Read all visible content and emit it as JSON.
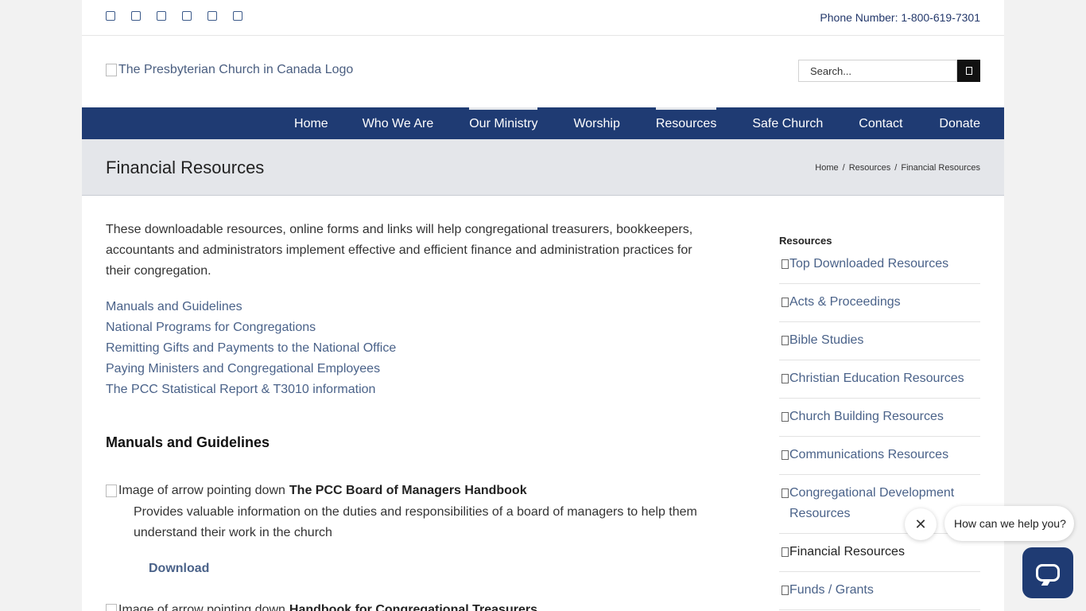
{
  "topbar": {
    "social_icons": [
      "facebook-icon",
      "twitter-icon",
      "instagram-icon",
      "youtube-icon",
      "flickr-icon",
      "email-icon"
    ],
    "phone": "Phone Number: 1-800-619-7301"
  },
  "header": {
    "logo_alt": "The Presbyterian Church in Canada Logo",
    "search_placeholder": "Search..."
  },
  "nav": {
    "items": [
      {
        "label": "Home",
        "active": false
      },
      {
        "label": "Who We Are",
        "active": false
      },
      {
        "label": "Our Ministry",
        "active": true
      },
      {
        "label": "Worship",
        "active": false
      },
      {
        "label": "Resources",
        "active": true
      },
      {
        "label": "Safe Church",
        "active": false
      },
      {
        "label": "Contact",
        "active": false
      },
      {
        "label": "Donate",
        "active": false
      }
    ]
  },
  "titlebar": {
    "title": "Financial Resources",
    "breadcrumbs": [
      "Home",
      "Resources",
      "Financial Resources"
    ]
  },
  "main": {
    "intro": "These downloadable resources, online forms and links will help congregational treasurers, bookkeepers, accountants and administrators implement effective and efficient finance and administration practices for their congregation.",
    "toc": [
      "Manuals and Guidelines",
      "National Programs for Congregations",
      "Remitting Gifts and Payments to the National Office",
      "Paying Ministers and Congregational Employees",
      "The PCC Statistical Report & T3010 information"
    ],
    "section_heading": "Manuals and Guidelines",
    "resource": {
      "image_alt": "Image of arrow pointing down",
      "title": "The PCC Board of Managers Handbook",
      "description": "Provides valuable information on the duties and responsibilities of a board of managers to help them understand their work in the church",
      "download_label": "Download"
    },
    "resource2": {
      "image_alt": "Image of arrow pointing down",
      "title": "Handbook for Congregational Treasurers"
    }
  },
  "sidebar": {
    "title": "Resources",
    "items": [
      {
        "label": "Top Downloaded Resources",
        "current": false
      },
      {
        "label": "Acts & Proceedings",
        "current": false
      },
      {
        "label": "Bible Studies",
        "current": false
      },
      {
        "label": "Christian Education Resources",
        "current": false
      },
      {
        "label": "Church Building Resources",
        "current": false
      },
      {
        "label": "Communications Resources",
        "current": false
      },
      {
        "label": "Congregational Development Resources",
        "current": false
      },
      {
        "label": "Financial Resources",
        "current": true
      },
      {
        "label": "Funds / Grants",
        "current": false
      }
    ]
  },
  "chat": {
    "prompt": "How can we help you?",
    "close_symbol": "✕"
  }
}
